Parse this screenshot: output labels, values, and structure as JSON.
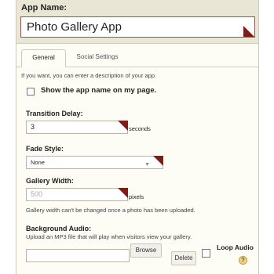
{
  "app_name": {
    "label": "App Name:",
    "value": "Photo Gallery App"
  },
  "tabs": [
    {
      "label": "General"
    },
    {
      "label": "Social Settings"
    }
  ],
  "description_hint": "If you want, you can enter a description of your app.",
  "show_name": {
    "label": "Show the app name on my page.",
    "checked": false
  },
  "transition_delay": {
    "label": "Transition Delay:",
    "value": "3",
    "unit": "seconds"
  },
  "fade_style": {
    "label": "Fade Style:",
    "value": "None"
  },
  "gallery_width": {
    "label": "Gallery Width:",
    "value": "500",
    "unit": "pixels",
    "note": "Gallery width can't be changed once a photo has been uploaded."
  },
  "background_audio": {
    "label": "Background Audio:",
    "note": "Upload an MP3 file that will play when visitors view your gallery.",
    "browse_label": "Browse",
    "delete_label": "Delete",
    "loop_label": "Loop Audio",
    "loop_checked": false,
    "help_glyph": "?"
  },
  "colors": {
    "accent": "#7b1e18",
    "panel": "#fdfcf5",
    "header": "#e9e6d5"
  }
}
